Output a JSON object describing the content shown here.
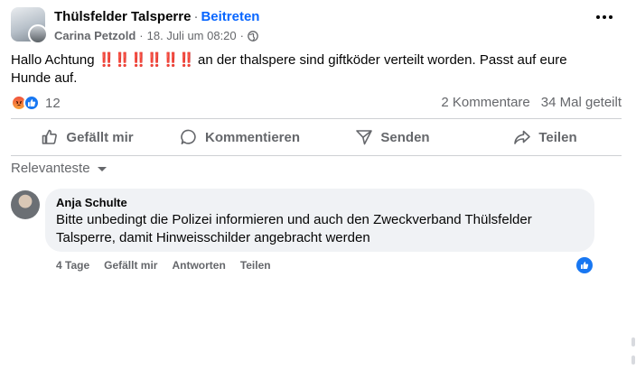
{
  "post": {
    "group_name": "Thülsfelder Talsperre",
    "separator": "·",
    "join_label": "Beitreten",
    "author": "Carina Petzold",
    "timestamp": "18. Juli um 08:20",
    "dot": "·",
    "text_before": "Hallo Achtung",
    "emphasis": "‼️‼️‼️‼️‼️‼️",
    "text_after": " an der thalspere sind giftköder verteilt worden. Passt auf eure Hunde auf.",
    "reaction_count": "12",
    "comments_count": "2 Kommentare",
    "shares_count": "34 Mal geteilt"
  },
  "actions": {
    "like": "Gefällt mir",
    "comment": "Kommentieren",
    "send": "Senden",
    "share": "Teilen"
  },
  "comments": {
    "sort_label": "Relevanteste",
    "items": [
      {
        "author": "Anja Schulte",
        "text": "Bitte unbedingt die Polizei informieren und auch den Zweckverband Thülsfelder Talsperre, damit Hinweisschilder angebracht werden",
        "age": "4 Tage",
        "like": "Gefällt mir",
        "reply": "Antworten",
        "share": "Teilen"
      }
    ]
  },
  "colors": {
    "accent": "#0866ff",
    "like_blue": "#1877f2",
    "muted_text": "#65676b",
    "bubble_bg": "#f0f2f5",
    "emphasis_red": "#e0245e"
  },
  "icons": [
    "more-icon",
    "globe-icon",
    "angry-reaction-icon",
    "like-reaction-icon",
    "thumbs-up-icon",
    "comment-icon",
    "send-icon",
    "share-icon",
    "caret-down-icon"
  ]
}
